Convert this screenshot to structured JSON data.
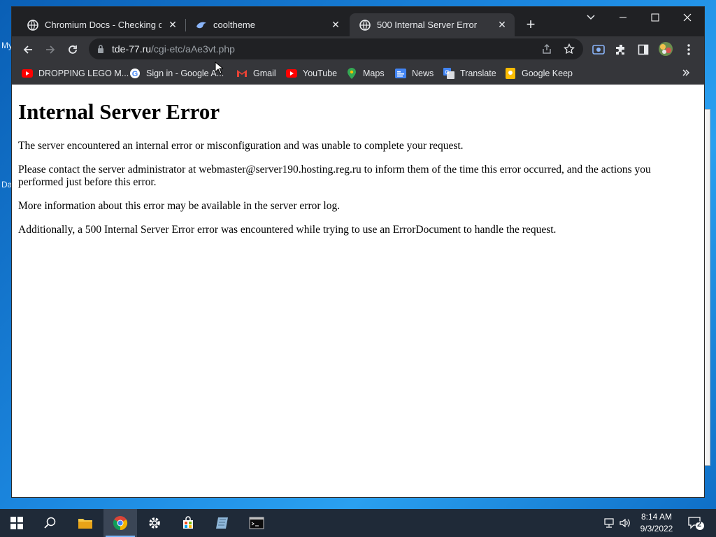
{
  "desktop": {
    "label_top": "My",
    "label_bottom": "Da"
  },
  "tabs": [
    {
      "title": "Chromium Docs - Checking out",
      "active": false
    },
    {
      "title": "cooltheme",
      "active": false
    },
    {
      "title": "500 Internal Server Error",
      "active": true
    }
  ],
  "window_controls": {
    "dropdown": "⌄",
    "minimize": "—",
    "maximize": "☐",
    "close": "✕"
  },
  "omnibox": {
    "domain": "tde-77.ru",
    "path": "/cgi-etc/aAe3vt.php"
  },
  "bookmarks": [
    {
      "label": "DROPPING LEGO M...",
      "icon": "youtube-icon"
    },
    {
      "label": "Sign in - Google A...",
      "icon": "google-icon"
    },
    {
      "label": "Gmail",
      "icon": "gmail-icon"
    },
    {
      "label": "YouTube",
      "icon": "youtube-icon"
    },
    {
      "label": "Maps",
      "icon": "maps-icon"
    },
    {
      "label": "News",
      "icon": "news-icon"
    },
    {
      "label": "Translate",
      "icon": "translate-icon"
    },
    {
      "label": "Google Keep",
      "icon": "keep-icon"
    }
  ],
  "page": {
    "heading": "Internal Server Error",
    "paragraphs": [
      "The server encountered an internal error or misconfiguration and was unable to complete your request.",
      "Please contact the server administrator at webmaster@server190.hosting.reg.ru to inform them of the time this error occurred, and the actions you performed just before this error.",
      "More information about this error may be available in the server error log.",
      "Additionally, a 500 Internal Server Error error was encountered while trying to use an ErrorDocument to handle the request."
    ]
  },
  "taskbar": {
    "time": "8:14 AM",
    "date": "9/3/2022",
    "notification_count": "2"
  },
  "colors": {
    "tabstrip_bg": "#202124",
    "toolbar_bg": "#35363a",
    "taskbar_bg": "#1f2a38",
    "desktop_bg": "#1c88e0"
  }
}
